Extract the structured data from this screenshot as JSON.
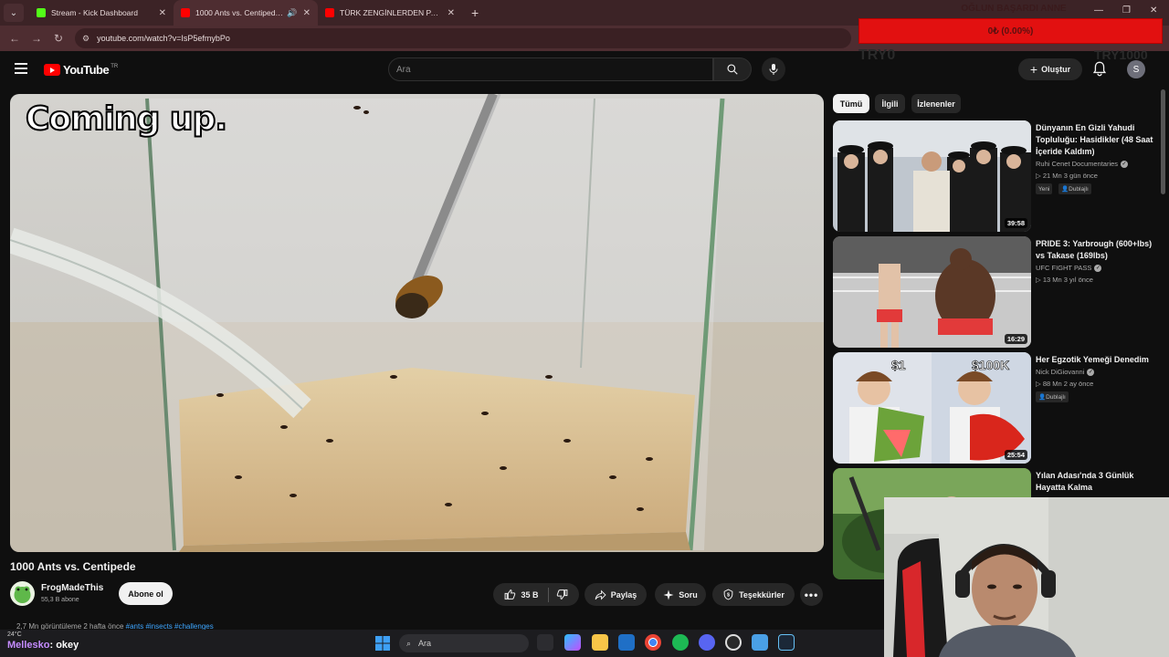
{
  "browser": {
    "tabs": [
      {
        "label": "Stream - Kick Dashboard",
        "favicon_color": "#53fc18",
        "active": false
      },
      {
        "label": "1000 Ants vs. Centipede - YouTube",
        "favicon_color": "#ff0000",
        "active": true
      },
      {
        "label": "TÜRK ZENGİNLERDEN PARA DİLENMEK",
        "favicon_color": "#ff0000",
        "active": false
      }
    ],
    "url": "youtube.com/watch?v=IsP5efmybPo",
    "accent": "#4e2d31"
  },
  "stream_overlay": {
    "goal_title": "OĞLUN BAŞARDI ANNE",
    "goal_progress": "0₺ (0.00%)",
    "goal_fraction": 0.0,
    "left_label": "TRY0",
    "right_label": "TRY1000",
    "bar_color": "#e21010"
  },
  "youtube": {
    "logo_text": "YouTube",
    "region": "TR",
    "search_placeholder": "Ara",
    "create_label": "Oluştur",
    "avatar_letter": "S"
  },
  "video": {
    "caption_overlay": "Coming up.",
    "title": "1000 Ants vs. Centipede",
    "channel": "FrogMadeThis",
    "subscribers": "55,3 B abone",
    "subscribe_label": "Abone ol",
    "likes": "35 B",
    "share_label": "Paylaş",
    "ask_label": "Soru",
    "thanks_label": "Teşekkürler",
    "meta": "2,7 Mn görüntüleme  2 hafta önce",
    "tags": "#ants #insects #challenges"
  },
  "chips": [
    {
      "label": "Tümü",
      "active": true
    },
    {
      "label": "İlgili",
      "active": false
    },
    {
      "label": "İzlenenler",
      "active": false
    }
  ],
  "recommendations": [
    {
      "title": "Dünyanın En Gizli Yahudi Topluluğu: Hasidikler (48 Saat İçeride Kaldım)",
      "channel": "Ruhi Cenet Documentaries",
      "meta": "21 Mn  3 gün önce",
      "duration": "39:58",
      "badges": [
        "Yeni",
        "Dublajlı"
      ]
    },
    {
      "title": "PRIDE 3: Yarbrough (600+lbs) vs Takase (169lbs)",
      "channel": "UFC FIGHT PASS",
      "meta": "13 Mn  3 yıl önce",
      "duration": "16:29",
      "badges": []
    },
    {
      "title": "Her Egzotik Yemeği Denedim",
      "channel": "Nick DiGiovanni",
      "meta": "88 Mn  2 ay önce",
      "duration": "25:54",
      "badges": [
        "Dublajlı"
      ],
      "thumb_text_left": "$1",
      "thumb_text_right": "$100K"
    },
    {
      "title": "Yılan Adası'nda 3 Günlük Hayatta Kalma",
      "channel": "",
      "meta": "",
      "duration": "",
      "badges": []
    }
  ],
  "taskbar": {
    "weather": "24°C",
    "chat_user": "Mellesko",
    "chat_text": ": okey",
    "search_placeholder": "Ara"
  }
}
